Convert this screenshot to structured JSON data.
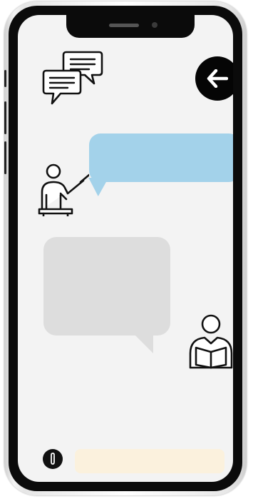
{
  "header": {
    "chat_icon": "chat-bubbles-icon",
    "back_icon": "arrow-left-icon"
  },
  "conversation": {
    "teacher": {
      "avatar_icon": "teacher-icon",
      "bubble_color": "#a3d2ea",
      "message": ""
    },
    "student": {
      "avatar_icon": "student-reading-icon",
      "bubble_color": "#dddddd",
      "message": ""
    }
  },
  "composer": {
    "attach_icon": "paperclip-icon",
    "input_value": "",
    "input_color": "#fbf1dd"
  }
}
